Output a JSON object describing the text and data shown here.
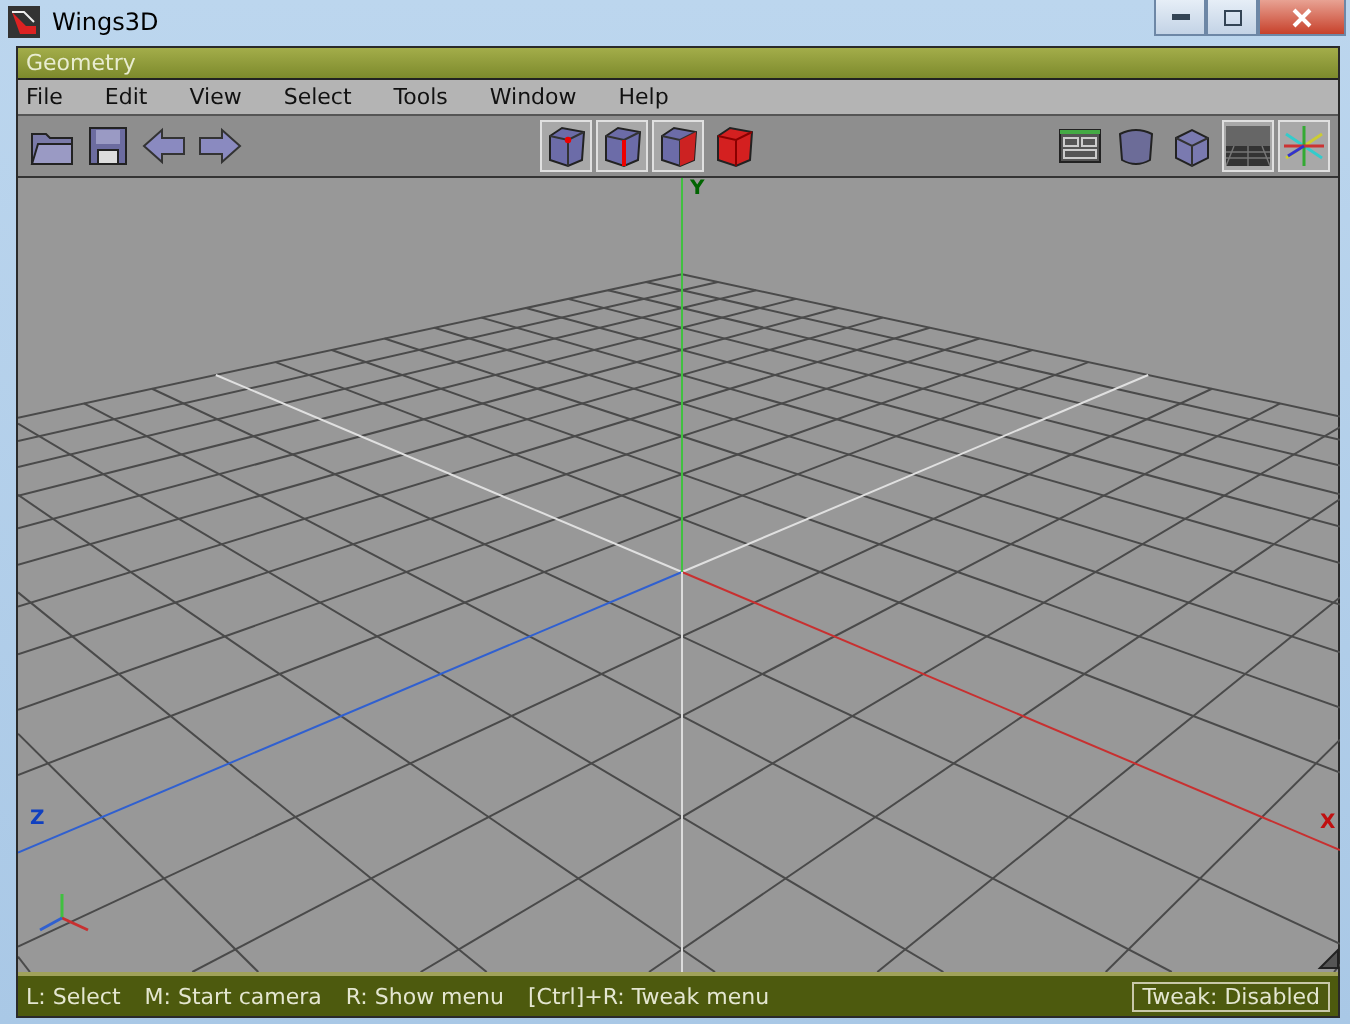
{
  "window": {
    "title": "Wings3D"
  },
  "panel": {
    "title": "Geometry"
  },
  "menu": [
    "File",
    "Edit",
    "View",
    "Select",
    "Tools",
    "Window",
    "Help"
  ],
  "file_buttons": [
    {
      "kind": "open"
    },
    {
      "kind": "save"
    },
    {
      "kind": "undo"
    },
    {
      "kind": "redo"
    }
  ],
  "select_modes": [
    {
      "kind": "vertex",
      "selected": true
    },
    {
      "kind": "edge",
      "selected": true
    },
    {
      "kind": "face",
      "selected": true
    },
    {
      "kind": "body",
      "selected": false
    }
  ],
  "view_buttons": [
    {
      "kind": "outliner",
      "on": false
    },
    {
      "kind": "smooth",
      "on": false
    },
    {
      "kind": "flat",
      "on": false
    },
    {
      "kind": "ground",
      "on": true
    },
    {
      "kind": "axes",
      "on": true
    }
  ],
  "viewport": {
    "axis_labels": [
      {
        "kind": "x",
        "label": "X"
      },
      {
        "kind": "y",
        "label": "Y"
      },
      {
        "kind": "z",
        "label": "Z"
      }
    ]
  },
  "status_bar": {
    "hints": [
      "L: Select",
      "M: Start camera",
      "R: Show menu",
      "[Ctrl]+R: Tweak menu"
    ],
    "tweak": "Tweak: Disabled"
  }
}
